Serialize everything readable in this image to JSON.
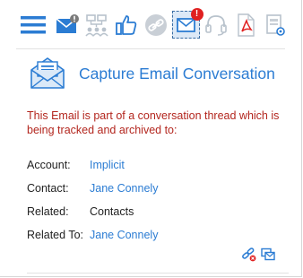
{
  "toolbar": {
    "items": [
      {
        "icon": "hamburger-menu-icon"
      },
      {
        "icon": "email-alert-icon"
      },
      {
        "icon": "org-chart-icon"
      },
      {
        "icon": "thumbs-up-icon"
      },
      {
        "icon": "link-icon"
      },
      {
        "icon": "capture-email-icon",
        "selected": true,
        "badge": "!"
      },
      {
        "icon": "headset-icon"
      },
      {
        "icon": "pdf-icon"
      },
      {
        "icon": "document-settings-icon"
      }
    ]
  },
  "panel": {
    "title": "Capture Email Conversation",
    "notice": "This Email is part of a conversation thread which is being tracked and archived to:",
    "rows": [
      {
        "label": "Account:",
        "value": "Implicit",
        "is_link": true
      },
      {
        "label": "Contact:",
        "value": "Jane Connely",
        "is_link": true
      },
      {
        "label": "Related:",
        "value": "Contacts",
        "is_link": false
      },
      {
        "label": "Related To:",
        "value": "Jane Connely",
        "is_link": true
      }
    ],
    "footer_icons": [
      "unlink-icon",
      "conversation-icon"
    ]
  },
  "colors": {
    "accent": "#2b7cd3",
    "notice_red": "#b3261e",
    "badge_red": "#e02020",
    "icon_gray": "#b8c2cc"
  }
}
